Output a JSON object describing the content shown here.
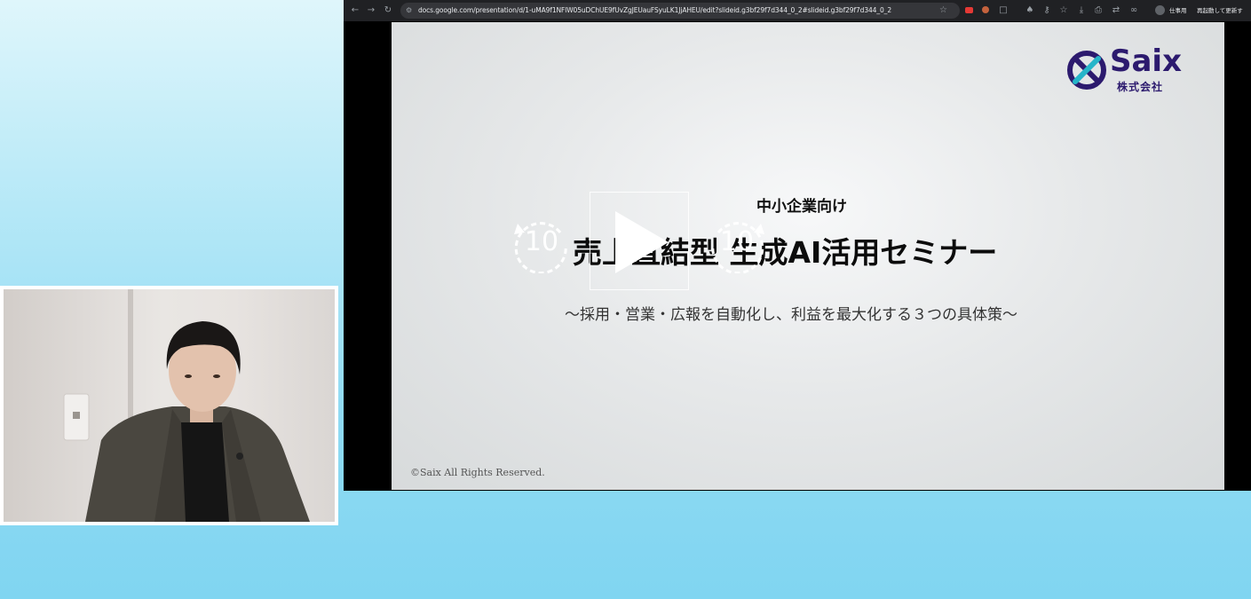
{
  "browser": {
    "url": "docs.google.com/presentation/d/1-uMA9f1NFlW05uDChUE9fUvZgJEUauFSyuLK1JjAHEU/edit?slideid.g3bf29f7d344_0_2#slideid.g3bf29f7d344_0_2",
    "profile_label": "仕事用",
    "restart_label": "再起動して更新す",
    "icons": [
      "back-arrow-icon",
      "forward-arrow-icon",
      "reload-icon",
      "site-settings-icon",
      "bookmark-star-icon",
      "extension-icons",
      "profile-icon"
    ]
  },
  "slide": {
    "logo_text": "Saix",
    "logo_sub": "株式会社",
    "pre_title": "中小企業向け",
    "title": "売上直結型 生成AI活用セミナー",
    "subtitle": "～採用・営業・広報を自動化し、利益を最大化する３つの具体策～",
    "copyright": "©Saix All Rights Reserved.",
    "brand_color": "#2c1a6e"
  },
  "player": {
    "rewind_label": "10",
    "forward_label": "10"
  }
}
